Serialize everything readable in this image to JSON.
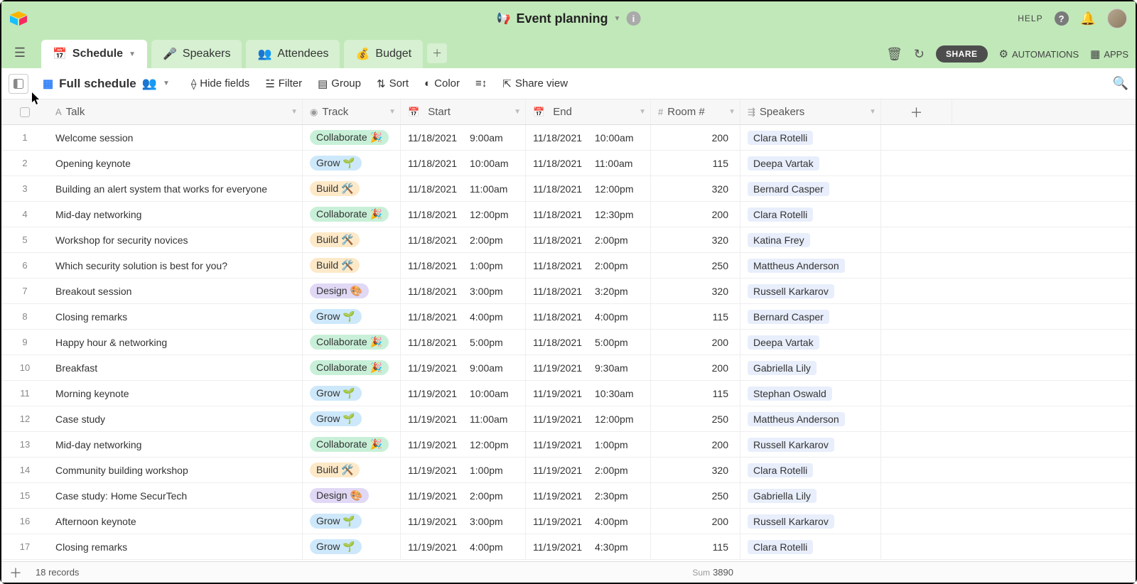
{
  "base_title": "Event planning",
  "header": {
    "help_label": "HELP",
    "share_label": "SHARE",
    "automations_label": "AUTOMATIONS",
    "apps_label": "APPS"
  },
  "tabs": [
    {
      "emoji": "📅",
      "label": "Schedule",
      "active": true,
      "has_dropdown": true
    },
    {
      "emoji": "🎤",
      "label": "Speakers"
    },
    {
      "emoji": "👥",
      "label": "Attendees"
    },
    {
      "emoji": "💰",
      "label": "Budget"
    }
  ],
  "view": {
    "name": "Full schedule",
    "controls": {
      "hide_fields": "Hide fields",
      "filter": "Filter",
      "group": "Group",
      "sort": "Sort",
      "color": "Color",
      "share_view": "Share view"
    }
  },
  "columns": {
    "talk": "Talk",
    "track": "Track",
    "start": "Start",
    "end": "End",
    "room": "Room #",
    "speakers": "Speakers"
  },
  "tracks": {
    "collaborate": {
      "label": "Collaborate",
      "emoji": "🎉",
      "class": "pill-collab"
    },
    "grow": {
      "label": "Grow",
      "emoji": "🌱",
      "class": "pill-grow"
    },
    "build": {
      "label": "Build",
      "emoji": "🛠️",
      "class": "pill-build"
    },
    "design": {
      "label": "Design",
      "emoji": "🎨",
      "class": "pill-design"
    }
  },
  "rows": [
    {
      "n": 1,
      "talk": "Welcome session",
      "track": "collaborate",
      "start_d": "11/18/2021",
      "start_t": "9:00am",
      "end_d": "11/18/2021",
      "end_t": "10:00am",
      "room": 200,
      "speaker": "Clara Rotelli"
    },
    {
      "n": 2,
      "talk": "Opening keynote",
      "track": "grow",
      "start_d": "11/18/2021",
      "start_t": "10:00am",
      "end_d": "11/18/2021",
      "end_t": "11:00am",
      "room": 115,
      "speaker": "Deepa Vartak"
    },
    {
      "n": 3,
      "talk": "Building an alert system that works for everyone",
      "track": "build",
      "start_d": "11/18/2021",
      "start_t": "11:00am",
      "end_d": "11/18/2021",
      "end_t": "12:00pm",
      "room": 320,
      "speaker": "Bernard Casper"
    },
    {
      "n": 4,
      "talk": "Mid-day networking",
      "track": "collaborate",
      "start_d": "11/18/2021",
      "start_t": "12:00pm",
      "end_d": "11/18/2021",
      "end_t": "12:30pm",
      "room": 200,
      "speaker": "Clara Rotelli"
    },
    {
      "n": 5,
      "talk": "Workshop for security novices",
      "track": "build",
      "start_d": "11/18/2021",
      "start_t": "2:00pm",
      "end_d": "11/18/2021",
      "end_t": "2:00pm",
      "room": 320,
      "speaker": "Katina Frey"
    },
    {
      "n": 6,
      "talk": "Which security solution is best for you?",
      "track": "build",
      "start_d": "11/18/2021",
      "start_t": "1:00pm",
      "end_d": "11/18/2021",
      "end_t": "2:00pm",
      "room": 250,
      "speaker": "Mattheus Anderson"
    },
    {
      "n": 7,
      "talk": "Breakout session",
      "track": "design",
      "start_d": "11/18/2021",
      "start_t": "3:00pm",
      "end_d": "11/18/2021",
      "end_t": "3:20pm",
      "room": 320,
      "speaker": "Russell Karkarov"
    },
    {
      "n": 8,
      "talk": "Closing remarks",
      "track": "grow",
      "start_d": "11/18/2021",
      "start_t": "4:00pm",
      "end_d": "11/18/2021",
      "end_t": "4:00pm",
      "room": 115,
      "speaker": "Bernard Casper"
    },
    {
      "n": 9,
      "talk": "Happy hour & networking",
      "track": "collaborate",
      "start_d": "11/18/2021",
      "start_t": "5:00pm",
      "end_d": "11/18/2021",
      "end_t": "5:00pm",
      "room": 200,
      "speaker": "Deepa Vartak"
    },
    {
      "n": 10,
      "talk": "Breakfast",
      "track": "collaborate",
      "start_d": "11/19/2021",
      "start_t": "9:00am",
      "end_d": "11/19/2021",
      "end_t": "9:30am",
      "room": 200,
      "speaker": "Gabriella Lily"
    },
    {
      "n": 11,
      "talk": "Morning keynote",
      "track": "grow",
      "start_d": "11/19/2021",
      "start_t": "10:00am",
      "end_d": "11/19/2021",
      "end_t": "10:30am",
      "room": 115,
      "speaker": "Stephan Oswald"
    },
    {
      "n": 12,
      "talk": "Case study",
      "track": "grow",
      "start_d": "11/19/2021",
      "start_t": "11:00am",
      "end_d": "11/19/2021",
      "end_t": "12:00pm",
      "room": 250,
      "speaker": "Mattheus Anderson"
    },
    {
      "n": 13,
      "talk": "Mid-day networking",
      "track": "collaborate",
      "start_d": "11/19/2021",
      "start_t": "12:00pm",
      "end_d": "11/19/2021",
      "end_t": "1:00pm",
      "room": 200,
      "speaker": "Russell Karkarov"
    },
    {
      "n": 14,
      "talk": "Community building workshop",
      "track": "build",
      "start_d": "11/19/2021",
      "start_t": "1:00pm",
      "end_d": "11/19/2021",
      "end_t": "2:00pm",
      "room": 320,
      "speaker": "Clara Rotelli"
    },
    {
      "n": 15,
      "talk": "Case study: Home SecurTech",
      "track": "design",
      "start_d": "11/19/2021",
      "start_t": "2:00pm",
      "end_d": "11/19/2021",
      "end_t": "2:30pm",
      "room": 250,
      "speaker": "Gabriella Lily"
    },
    {
      "n": 16,
      "talk": "Afternoon keynote",
      "track": "grow",
      "start_d": "11/19/2021",
      "start_t": "3:00pm",
      "end_d": "11/19/2021",
      "end_t": "4:00pm",
      "room": 200,
      "speaker": "Russell Karkarov"
    },
    {
      "n": 17,
      "talk": "Closing remarks",
      "track": "grow",
      "start_d": "11/19/2021",
      "start_t": "4:00pm",
      "end_d": "11/19/2021",
      "end_t": "4:30pm",
      "room": 115,
      "speaker": "Clara Rotelli"
    }
  ],
  "footer": {
    "record_count": "18 records",
    "sum_label": "Sum",
    "sum_value": "3890"
  }
}
